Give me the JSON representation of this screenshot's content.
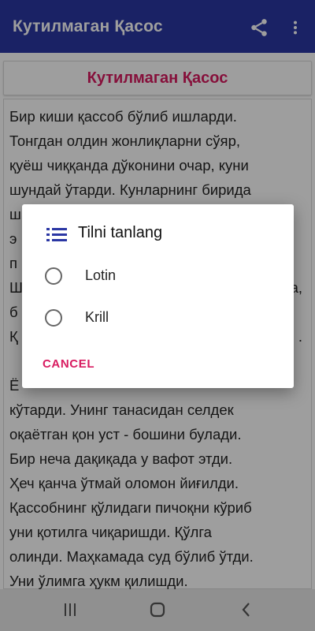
{
  "appbar": {
    "title": "Кутилмаган Қасос",
    "share_icon": "share-icon",
    "more_icon": "more-vert-icon",
    "background": "#2b37a4"
  },
  "story": {
    "heading": "Кутилмаган Қасос",
    "paragraph1_lines": [
      "Бир киши қассоб бўлиб ишларди.",
      "Тонгдан олдин жонлиқларни сўяр,",
      "қуёш чиққанда дўконини очар, куни",
      "шундай ўтарди. Кунларнинг бирида",
      "ш",
      "э",
      "п",
      "Ш",
      "б",
      "Қ"
    ],
    "paragraph1_fragments_right": [
      "а,",
      "."
    ],
    "paragraph2_lines": [
      "Ё",
      "кўтарди. Унинг танасидан селдек",
      "оқаётган қон уст - бошини булади.",
      "Бир неча дақиқада у вафот этди.",
      "Ҳеч қанча ўтмай оломон йиғилди.",
      "Қассобнинг қўлидаги пичоқни кўриб",
      "уни қотилга чиқаришди. Қўлга",
      "олинди. Маҳкамада суд бўлиб ўтди.",
      "Уни ўлимга ҳукм қилишди."
    ]
  },
  "dialog": {
    "icon": "list-icon",
    "title": "Tilni tanlang",
    "options": [
      {
        "label": "Lotin",
        "selected": false
      },
      {
        "label": "Krill",
        "selected": false
      }
    ],
    "cancel_label": "CANCEL",
    "accent": "#d81b60"
  },
  "navbar": {
    "recents_icon": "recents-icon",
    "home_icon": "home-icon",
    "back_icon": "back-icon"
  }
}
